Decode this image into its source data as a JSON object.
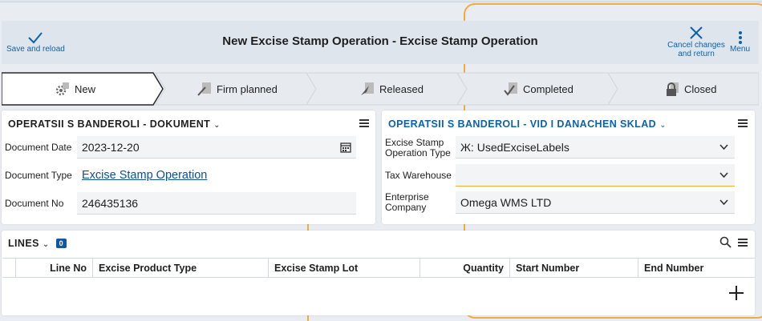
{
  "header": {
    "save_label": "Save and reload",
    "title": "New Excise Stamp Operation - Excise Stamp Operation",
    "cancel_label": "Cancel changes and return",
    "menu_label": "Menu"
  },
  "flow": {
    "steps": [
      {
        "label": "New",
        "icon": "gear-icon"
      },
      {
        "label": "Firm planned",
        "icon": "firm-planned-icon"
      },
      {
        "label": "Released",
        "icon": "released-icon"
      },
      {
        "label": "Completed",
        "icon": "completed-icon"
      },
      {
        "label": "Closed",
        "icon": "lock-icon"
      }
    ],
    "active_step": "New"
  },
  "document_panel": {
    "title": "OPERATSII S BANDEROLI - DOKUMENT",
    "fields": {
      "date_label": "Document Date",
      "date_value": "2023-12-20",
      "type_label": "Document Type",
      "type_value": "Excise Stamp Operation",
      "no_label": "Document No",
      "no_value": "246435136"
    }
  },
  "warehouse_panel": {
    "title": "OPERATSII S BANDEROLI - VID I DANACHEN SKLAD",
    "fields": {
      "op_type_label_1": "Excise Stamp",
      "op_type_label_2": "Operation Type",
      "op_type_value": "Ж: UsedExciseLabels",
      "tax_wh_label": "Tax Warehouse",
      "tax_wh_value": "",
      "company_label_1": "Enterprise",
      "company_label_2": "Company",
      "company_value": "Omega WMS LTD"
    }
  },
  "lines": {
    "title": "LINES",
    "count": "0",
    "columns": [
      "Line No",
      "Excise Product Type",
      "Excise Stamp Lot",
      "Quantity",
      "Start Number",
      "End Number"
    ]
  },
  "colors": {
    "accent_blue": "#0a62ad",
    "badge_blue": "#1256a6",
    "focus_orange": "#f0ac3c",
    "header_bg": "#dfe5ec"
  }
}
